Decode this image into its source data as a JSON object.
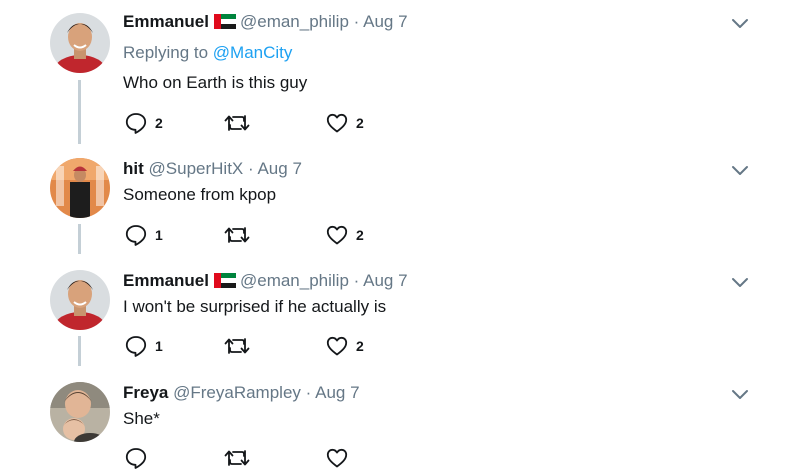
{
  "replies": [
    {
      "name": "Emmanuel",
      "handle": "@eman_philip",
      "separator": "·",
      "date": "Aug 7",
      "replying_prefix": "Replying to",
      "replying_mention": "@ManCity",
      "text": "Who on Earth is this guy",
      "reply_count": "2",
      "retweet_count": "",
      "like_count": "2",
      "avatar_icon": "person-red-jersey",
      "flag_icon": "uae-flag-icon"
    },
    {
      "name": "hit",
      "handle": "@SuperHitX",
      "separator": "·",
      "date": "Aug 7",
      "text": "Someone from kpop",
      "reply_count": "1",
      "retweet_count": "",
      "like_count": "2",
      "avatar_icon": "person-orange-background"
    },
    {
      "name": "Emmanuel",
      "handle": "@eman_philip",
      "separator": "·",
      "date": "Aug 7",
      "text": "I won't be surprised if he actually is",
      "reply_count": "1",
      "retweet_count": "",
      "like_count": "2",
      "avatar_icon": "person-red-jersey",
      "flag_icon": "uae-flag-icon"
    },
    {
      "name": "Freya",
      "handle": "@FreyaRampley",
      "separator": "·",
      "date": "Aug 7",
      "text": "She*",
      "reply_count": "",
      "retweet_count": "",
      "like_count": "",
      "avatar_icon": "two-people-photo"
    }
  ],
  "colors": {
    "text": "#14171a",
    "secondary": "#657786",
    "link": "#1da1f2",
    "thread_line": "#c4cfd6"
  }
}
